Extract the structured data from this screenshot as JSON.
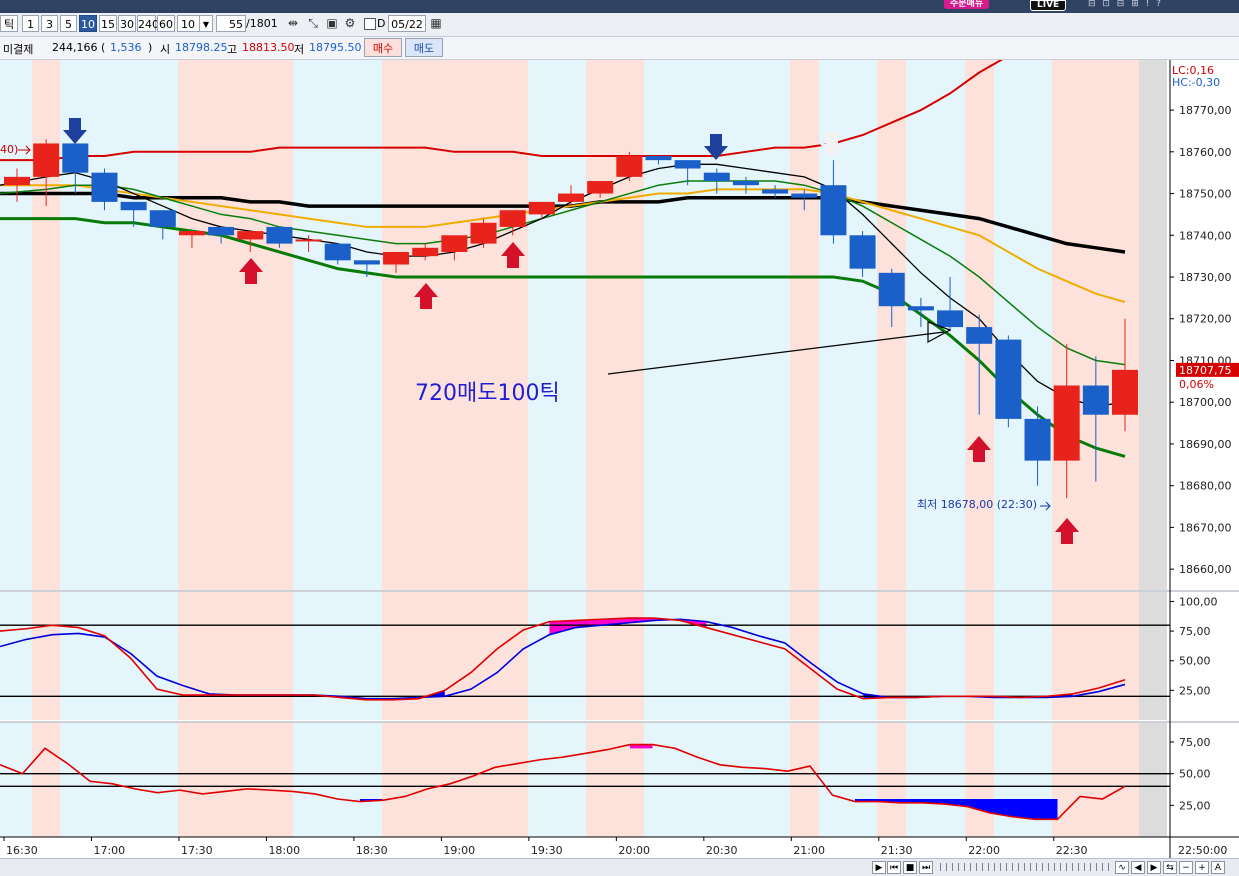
{
  "titlebar": {
    "badge_order": "주문매뉴",
    "badge_live": "LIVE",
    "controls": "⊟ ⊡ ⊟ ⊞ ! ?"
  },
  "toolbar": {
    "period_label": "틱",
    "periods": [
      "1",
      "3",
      "5",
      "10",
      "15",
      "30",
      "240",
      "60"
    ],
    "active_period": "10",
    "count_value": "10",
    "range_value": "55",
    "range_total": "/1801",
    "date_check_label": "D",
    "date_value": "05/22"
  },
  "quote": {
    "unsettled_label": "미결제",
    "unsettled_value": "244,166",
    "unsettled_change_open": "(",
    "unsettled_change": "1,536",
    "unsettled_change_close": ")",
    "open_label": "시",
    "open_value": "18798.25",
    "high_label": "고",
    "high_value": "18813.50",
    "low_label": "저",
    "low_value": "18795.50",
    "buy_label": "매수",
    "sell_label": "매도"
  },
  "colors": {
    "up": "#e8231b",
    "down": "#1b5fc9",
    "band": "#d60000",
    "ma_fast": "#000000",
    "ma_mid": "#0a7d0a",
    "ma_gold": "#f0ad00",
    "ma_slow": "#000000",
    "ma_green": "#087a08",
    "bg_blue": "#e4f5fb",
    "bg_pink": "#fde2dc",
    "osc_red": "#e00000",
    "osc_blue": "#0000dd",
    "fill_pos": "#ff00cc",
    "fill_neg": "#0000ff"
  },
  "chart_data": {
    "type": "candlestick",
    "x_ticks": [
      "16:30",
      "17:00",
      "17:30",
      "18:00",
      "18:30",
      "19:00",
      "19:30",
      "20:00",
      "20:30",
      "21:00",
      "21:30",
      "22:00",
      "22:30"
    ],
    "x_end_label": "22:50:00",
    "main": {
      "ylim": [
        18655,
        18782
      ],
      "y_ticks": [
        "18770,00",
        "18760,00",
        "18750,00",
        "18740,00",
        "18730,00",
        "18720,00",
        "18710,00",
        "18700,00",
        "18690,00",
        "18680,00",
        "18670,00",
        "18660,00"
      ],
      "y_tick_values": [
        18770,
        18760,
        18750,
        18740,
        18730,
        18720,
        18710,
        18700,
        18690,
        18680,
        18670,
        18660
      ],
      "lc_label": "LC:0,16",
      "hc_label": "HC:-0,30",
      "current_price": "18707,75",
      "current_pct": "0,06%",
      "low_annotation": "최저 18678,00 (22:30)",
      "left_cut_label": "40)",
      "annotation_text": "720매도100틱",
      "candles": [
        [
          18752,
          18756,
          18748,
          18754
        ],
        [
          18754,
          18763,
          18747,
          18762
        ],
        [
          18762,
          18762,
          18750,
          18755
        ],
        [
          18755,
          18756,
          18746,
          18748
        ],
        [
          18748,
          18748,
          18742,
          18746
        ],
        [
          18746,
          18746,
          18739,
          18742
        ],
        [
          18740,
          18741,
          18737,
          18741
        ],
        [
          18742,
          18742,
          18738,
          18740
        ],
        [
          18739,
          18741,
          18736,
          18741
        ],
        [
          18742,
          18742,
          18737,
          18738
        ],
        [
          18739,
          18740,
          18736,
          18739
        ],
        [
          18738,
          18738,
          18733,
          18734
        ],
        [
          18734,
          18734,
          18730,
          18733
        ],
        [
          18733,
          18736,
          18731,
          18736
        ],
        [
          18735,
          18738,
          18734,
          18737
        ],
        [
          18736,
          18740,
          18734,
          18740
        ],
        [
          18738,
          18744,
          18737,
          18743
        ],
        [
          18742,
          18746,
          18740,
          18746
        ],
        [
          18745,
          18748,
          18744,
          18748
        ],
        [
          18748,
          18752,
          18747,
          18750
        ],
        [
          18750,
          18753,
          18749,
          18753
        ],
        [
          18754,
          18760,
          18753,
          18759
        ],
        [
          18759,
          18759,
          18757,
          18758
        ],
        [
          18758,
          18758,
          18752,
          18756
        ],
        [
          18755,
          18756,
          18750,
          18753
        ],
        [
          18753,
          18754,
          18750,
          18752
        ],
        [
          18751,
          18752,
          18749,
          18750
        ],
        [
          18750,
          18751,
          18746,
          18749
        ],
        [
          18752,
          18758,
          18738,
          18740
        ],
        [
          18740,
          18741,
          18730,
          18732
        ],
        [
          18731,
          18732,
          18718,
          18723
        ],
        [
          18723,
          18725,
          18718,
          18722
        ],
        [
          18722,
          18730,
          18717,
          18718
        ],
        [
          18718,
          18721,
          18697,
          18714
        ],
        [
          18715,
          18716,
          18694,
          18696
        ],
        [
          18696,
          18699,
          18680,
          18686
        ],
        [
          18686,
          18714,
          18677,
          18704
        ],
        [
          18704,
          18711,
          18681,
          18697
        ],
        [
          18697,
          18720,
          18693,
          18707.75
        ]
      ]
    },
    "stoch": {
      "ylim": [
        0,
        108
      ],
      "y_ticks": [
        "100,00",
        "75,00",
        "50,00",
        "25,00"
      ],
      "y_tick_values": [
        100,
        75,
        50,
        25
      ],
      "hlines": [
        80,
        20
      ],
      "fast": [
        75,
        77,
        80,
        78,
        71,
        52,
        26,
        21,
        21,
        21,
        21,
        21,
        21,
        19,
        17,
        17,
        18,
        25,
        40,
        60,
        76,
        83,
        84,
        85,
        86,
        86,
        84,
        78,
        72,
        66,
        60,
        43,
        26,
        18,
        19,
        19,
        20,
        20,
        20,
        19,
        20,
        22,
        27,
        34
      ],
      "slow": [
        62,
        68,
        72,
        73,
        70,
        56,
        37,
        29,
        22,
        21,
        21,
        21,
        21,
        20,
        18,
        18,
        19,
        20,
        26,
        40,
        60,
        72,
        78,
        80,
        82,
        84,
        85,
        83,
        78,
        71,
        65,
        48,
        32,
        22,
        19,
        19,
        20,
        20,
        19,
        19,
        19,
        20,
        24,
        30
      ]
    },
    "rsi": {
      "ylim": [
        0,
        90
      ],
      "y_ticks": [
        "75,00",
        "50,00",
        "25,00"
      ],
      "y_tick_values": [
        75,
        50,
        25
      ],
      "hlines": [
        50,
        40
      ],
      "values": [
        57,
        50,
        70,
        58,
        44,
        42,
        38,
        35,
        37,
        34,
        36,
        38,
        37,
        36,
        34,
        30,
        28,
        29,
        32,
        38,
        42,
        48,
        55,
        58,
        61,
        63,
        66,
        69,
        73,
        73,
        70,
        63,
        57,
        55,
        54,
        52,
        56,
        33,
        28,
        28,
        27,
        27,
        26,
        24,
        19,
        16,
        14,
        14,
        32,
        30,
        40
      ]
    }
  }
}
